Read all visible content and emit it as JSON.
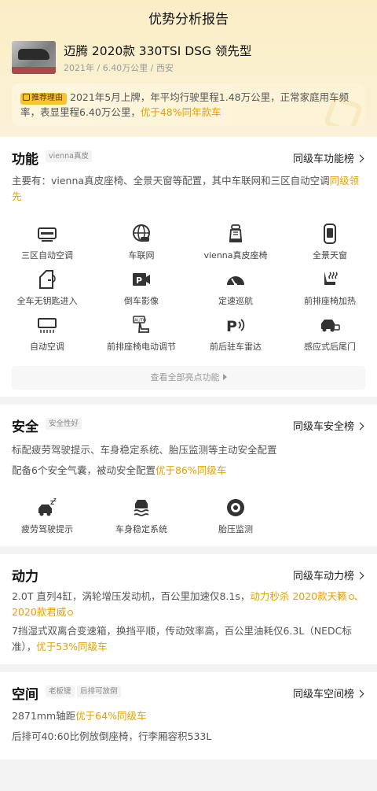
{
  "page": {
    "title": "优势分析报告"
  },
  "car": {
    "name": "迈腾 2020款 330TSI DSG 领先型",
    "meta": "2021年 / 6.40万公里 / 西安"
  },
  "reason": {
    "badge": "推荐理由",
    "text": "2021年5月上牌，年平均行驶里程1.48万公里，正常家庭用车频率，表显里程6.40万公里，",
    "highlight": "优于48%同年款车"
  },
  "function": {
    "title": "功能",
    "tag": "vienna真皮",
    "rank_link": "同级车功能榜",
    "desc": "主要有：vienna真皮座椅、全景天窗等配置，其中车联网和三区自动空调",
    "desc_highlight": "同级领先",
    "features": [
      {
        "label": "三区自动空调",
        "icon": "climate-panel-icon"
      },
      {
        "label": "车联网",
        "icon": "globe-car-icon"
      },
      {
        "label": "vienna真皮座椅",
        "icon": "leather-seat-icon"
      },
      {
        "label": "全景天窗",
        "icon": "panoramic-roof-icon"
      },
      {
        "label": "全车无钥匙进入",
        "icon": "keyless-door-icon"
      },
      {
        "label": "倒车影像",
        "icon": "reverse-camera-icon"
      },
      {
        "label": "定速巡航",
        "icon": "cruise-gauge-icon"
      },
      {
        "label": "前排座椅加热",
        "icon": "seat-heat-icon"
      },
      {
        "label": "自动空调",
        "icon": "auto-ac-icon"
      },
      {
        "label": "前排座椅电动调节",
        "icon": "power-seat-icon"
      },
      {
        "label": "前后驻车雷达",
        "icon": "parking-radar-icon"
      },
      {
        "label": "感应式后尾门",
        "icon": "sensor-tailgate-icon"
      }
    ],
    "more_label": "查看全部亮点功能"
  },
  "safety": {
    "title": "安全",
    "tag": "安全性好",
    "rank_link": "同级车安全榜",
    "line1": "标配疲劳驾驶提示、车身稳定系统、胎压监测等主动安全配置",
    "line2": "配备6个安全气囊，被动安全配置",
    "line2_highlight": "优于86%同级车",
    "features": [
      {
        "label": "疲劳驾驶提示",
        "icon": "fatigue-car-icon"
      },
      {
        "label": "车身稳定系统",
        "icon": "stability-car-icon"
      },
      {
        "label": "胎压监测",
        "icon": "tire-pressure-icon"
      }
    ]
  },
  "power": {
    "title": "动力",
    "rank_link": "同级车动力榜",
    "line1": "2.0T 直列4缸，涡轮增压发动机，百公里加速仅8.1s，",
    "line1_highlight": "动力秒杀 2020款天籁",
    "line1_highlight2": "、 2020款君威",
    "line2": "7挡湿式双离合变速箱，换挡平顺，传动效率高，百公里油耗仅6.3L（NEDC标准），",
    "line2_highlight": "优于53%同级车"
  },
  "space": {
    "title": "空间",
    "tags": [
      "老板键",
      "后排可放倒"
    ],
    "rank_link": "同级车空间榜",
    "line1": "2871mm轴距",
    "line1_highlight": "优于64%同级车",
    "line2": "后排可40:60比例放倒座椅，行李厢容积533L"
  },
  "colors": {
    "accent": "#e3a100",
    "badge": "#f5c430",
    "icon": "#333333"
  }
}
